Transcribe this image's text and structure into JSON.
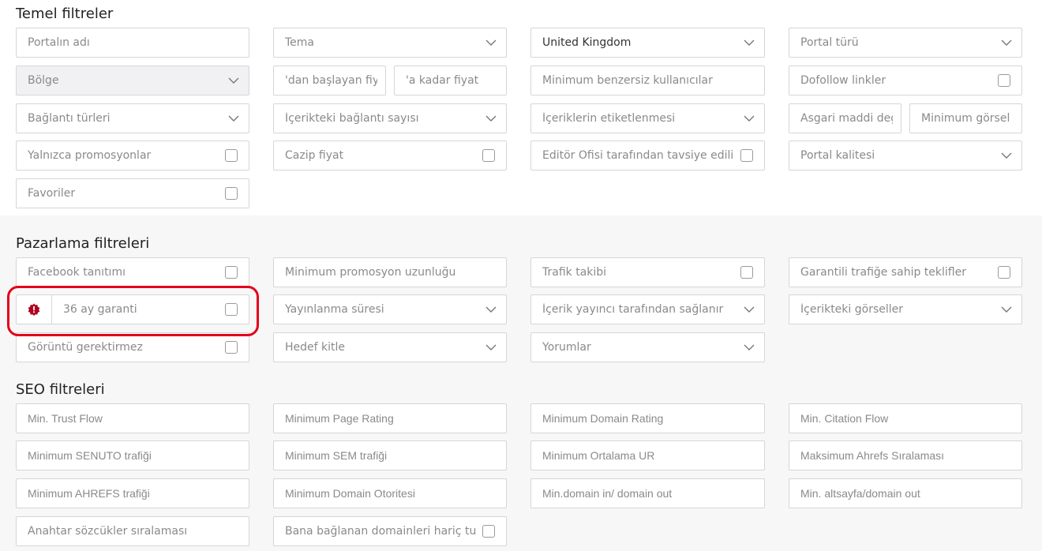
{
  "sections": {
    "basic": {
      "title": "Temel filtreler",
      "portal_name": "Portalın adı",
      "theme": "Tema",
      "country": "United Kingdom",
      "portal_type": "Portal türü",
      "region": "Bölge",
      "price_from": "'dan başlayan fiyat",
      "price_to": "'a kadar fiyat",
      "min_unique_users": "Minimum benzersiz kullanıcılar",
      "dofollow_links": "Dofollow linkler",
      "link_types": "Bağlantı türleri",
      "links_in_content": "İçerikteki bağlantı sayısı",
      "content_tagging": "İçeriklerin etiketlenmesi",
      "min_material_value": "Asgari maddi değer",
      "min_image": "Minimum görsel ve",
      "promotions_only": "Yalnızca promosyonlar",
      "attractive_price": "Cazip fiyat",
      "editor_recommended": "Editör Ofisi tarafından tavsiye edilir",
      "portal_quality": "Portal kalitesi",
      "favorites": "Favoriler"
    },
    "marketing": {
      "title": "Pazarlama filtreleri",
      "facebook_promo": "Facebook tanıtımı",
      "min_promo_length": "Minimum promosyon uzunluğu",
      "traffic_tracking": "Trafik takibi",
      "guaranteed_traffic": "Garantili trafiğe sahip teklifler",
      "guarantee_36": "36 ay garanti",
      "publish_duration": "Yayınlanma süresi",
      "content_by_publisher": "İçerik yayıncı tarafından sağlanır",
      "images_in_content": "İçerikteki görseller",
      "no_image_required": "Görüntü gerektirmez",
      "target_audience": "Hedef kitle",
      "comments": "Yorumlar"
    },
    "seo": {
      "title": "SEO filtreleri",
      "min_trust_flow": "Min. Trust Flow",
      "min_page_rating": "Minimum Page Rating",
      "min_domain_rating": "Minimum Domain Rating",
      "min_citation_flow": "Min. Citation Flow",
      "min_senuto": "Minimum SENUTO trafiği",
      "min_sem": "Minimum SEM trafiği",
      "min_avg_ur": "Minimum Ortalama UR",
      "max_ahrefs_rank": "Maksimum Ahrefs Sıralaması",
      "min_ahrefs": "Minimum AHREFS trafiği",
      "min_domain_authority": "Minimum Domain Otoritesi",
      "min_domain_in_out": "Min.domain in/ domain out",
      "min_subpage_domain_out": "Min. altsayfa/domain out",
      "keyword_ranking": "Anahtar sözcükler sıralaması",
      "exclude_linking_domains": "Bana bağlanan domainleri hariç tut"
    }
  },
  "colors": {
    "highlight": "#e3001b",
    "badge": "#b0001e"
  },
  "icons": {
    "chevron": "chevron-down-icon",
    "badge": "badge-alert-icon"
  }
}
